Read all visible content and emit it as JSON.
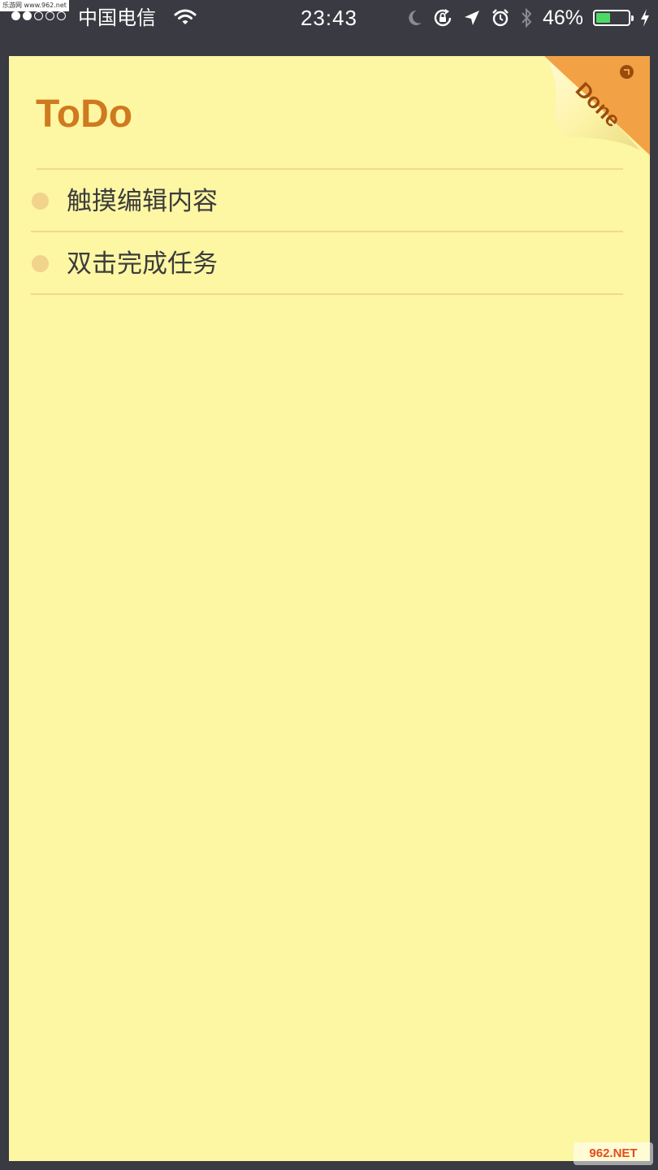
{
  "status_bar": {
    "watermark": "乐游网 www.962.net",
    "carrier": "中国电信",
    "time": "23:43",
    "battery_percent": "46%",
    "battery_level": 0.46,
    "battery_color": "#4cd964",
    "signal_bars_filled": 2,
    "icons": [
      "wifi-icon",
      "moon-icon",
      "orientation-lock-icon",
      "location-arrow-icon",
      "alarm-icon",
      "bluetooth-icon",
      "charging-bolt-icon"
    ]
  },
  "note": {
    "title": "ToDo",
    "paper_color": "#fdf6a3",
    "title_color": "#cf7a1e",
    "tasks": [
      {
        "text": "触摸编辑内容"
      },
      {
        "text": "双击完成任务"
      }
    ],
    "done_corner": {
      "label": "Done",
      "color": "#f2a244"
    }
  },
  "watermark_bottom": "962.NET"
}
